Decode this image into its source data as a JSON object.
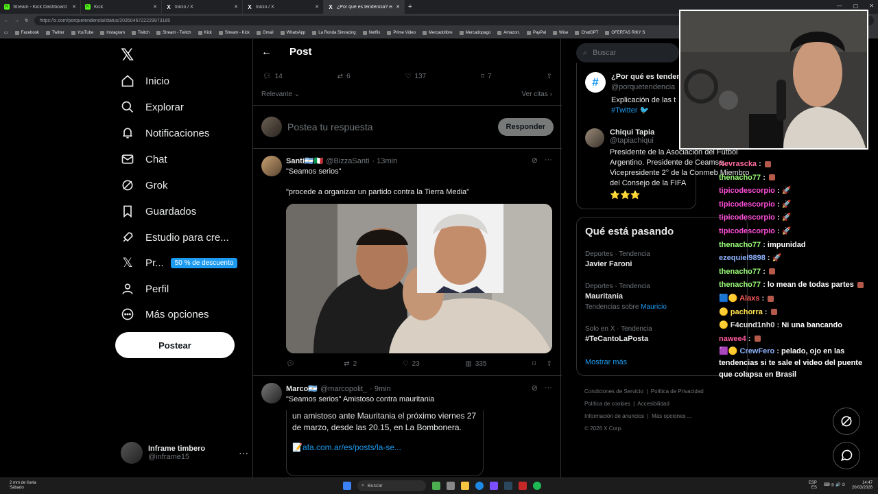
{
  "browser": {
    "tabs": [
      {
        "title": "Stream - Kick Dashboard",
        "icon": "kick-icon",
        "active": false
      },
      {
        "title": "Kick",
        "icon": "kick-icon",
        "active": false
      },
      {
        "title": "Inicio / X",
        "icon": "x-icon",
        "active": false
      },
      {
        "title": "Inicio / X",
        "icon": "x-icon",
        "active": false
      },
      {
        "title": "¿Por qué es tendencia? en X",
        "icon": "x-icon",
        "active": true
      }
    ],
    "url": "https://x.com/porquetendencia/status/2035046722229973185",
    "bookmarks": [
      "Facebook",
      "Twitter",
      "YouTube",
      "Instagram",
      "Twitch",
      "Stream - Twitch",
      "Kick",
      "Stream - Kick",
      "Gmail",
      "WhatsApp",
      "La Ronda Simracing",
      "Netflix",
      "Prime Video",
      "Mercadolibre",
      "Mercadopago",
      "Amazon.",
      "PayPal",
      "Wise",
      "ChatGPT",
      "OFERTAS RIKY S"
    ]
  },
  "nav": {
    "items": [
      {
        "label": "Inicio",
        "icon": "home-icon"
      },
      {
        "label": "Explorar",
        "icon": "search-icon"
      },
      {
        "label": "Notificaciones",
        "icon": "bell-icon"
      },
      {
        "label": "Chat",
        "icon": "mail-icon"
      },
      {
        "label": "Grok",
        "icon": "grok-icon"
      },
      {
        "label": "Guardados",
        "icon": "bookmark-icon"
      },
      {
        "label": "Estudio para cre...",
        "icon": "rocket-icon"
      },
      {
        "label": "Pr...",
        "icon": "x-premium-icon"
      },
      {
        "label": "Perfil",
        "icon": "person-icon"
      },
      {
        "label": "Más opciones",
        "icon": "more-circle-icon"
      }
    ],
    "premium_badge": "50 % de descuento",
    "post_button": "Postear",
    "account": {
      "name": "Inframe timbero",
      "handle": "@inframe15"
    }
  },
  "main": {
    "header": "Post",
    "stats": {
      "replies": "14",
      "reposts": "6",
      "likes": "137",
      "bookmarks": "7"
    },
    "sort_label": "Relevante",
    "quotes_link": "Ver citas",
    "reply_placeholder": "Postea tu respuesta",
    "reply_button": "Responder",
    "tweets": [
      {
        "name": "Santi🇦🇷🇮🇹",
        "handle": "@BizzaSanti",
        "time": "· 13min",
        "text1": "\"Seamos serios\"",
        "text2": "\"procede a organizar un partido contra la Tierra Media\"",
        "replies": "",
        "reposts": "2",
        "likes": "23",
        "views": "335"
      },
      {
        "name": "Marco🇦🇷",
        "handle": "@marcopolit_",
        "time": "· 9min",
        "text1": "\"Seamos serios\" Amistoso contra mauritania",
        "quote": "un amistoso ante Mauritania el próximo viernes 27 de marzo, desde las 20.15, en La Bombonera.",
        "quote_link": "📝afa.com.ar/es/posts/la-se..."
      }
    ]
  },
  "sidebar": {
    "search_placeholder": "Buscar",
    "account1": {
      "name": "¿Por qué es tenden",
      "handle": "@porquetendencia",
      "bio": "Explicación de las t",
      "tag": "#Twitter 🐦"
    },
    "account2": {
      "name": "Chiqui Tapia",
      "handle": "@tapiachiqui",
      "bio": "Presidente de la Asociación del Fútbol Argentino. Presidente de Ceamse. Vicepresidente 2° de la Conmeb Miembro del Consejo de la FIFA",
      "stars": "⭐⭐⭐"
    },
    "trending_title": "Qué está pasando",
    "trends": [
      {
        "context": "Deportes · Tendencia",
        "name": "Javier Faroni",
        "sub_prefix": "",
        "sub_link": ""
      },
      {
        "context": "Deportes · Tendencia",
        "name": "Mauritania",
        "sub_prefix": "Tendencias sobre ",
        "sub_link": "Mauricio"
      },
      {
        "context": "Solo en X · Tendencia",
        "name": "#TeCantoLaPosta",
        "sub_prefix": "",
        "sub_link": ""
      }
    ],
    "show_more": "Mostrar más",
    "footer": [
      "Condiciones de Servicio",
      "Política de Privacidad",
      "Política de cookies",
      "Accesibilidad",
      "Información de anuncios",
      "Más opciones ...",
      "© 2026 X Corp."
    ]
  },
  "stream_chat": [
    {
      "user": "Nevrascka",
      "color": "#ff6b9d",
      "msg": ""
    },
    {
      "user": "thenacho77",
      "color": "#9cff7a",
      "msg": ""
    },
    {
      "user": "tipicodescorpio",
      "color": "#ff4fd8",
      "msg": ""
    },
    {
      "user": "tipicodescorpio",
      "color": "#ff4fd8",
      "msg": ""
    },
    {
      "user": "tipicodescorpio",
      "color": "#ff4fd8",
      "msg": ""
    },
    {
      "user": "tipicodescorpio",
      "color": "#ff4fd8",
      "msg": ""
    },
    {
      "user": "thenacho77",
      "color": "#9cff7a",
      "msg": "impunidad"
    },
    {
      "user": "ezequiel9898",
      "color": "#8fb4ff",
      "msg": ""
    },
    {
      "user": "thenacho77",
      "color": "#9cff7a",
      "msg": ""
    },
    {
      "user": "thenacho77",
      "color": "#9cff7a",
      "msg": "lo mean de todas partes"
    },
    {
      "user": "Alaxs",
      "color": "#ff5a5a",
      "msg": ""
    },
    {
      "user": "pachorra",
      "color": "#ffe14d",
      "msg": ""
    },
    {
      "user": "F4cund1nh0",
      "color": "#e0e0e0",
      "msg": "Ni una bancando"
    },
    {
      "user": "nawee4",
      "color": "#ff5aa0",
      "msg": ""
    },
    {
      "user": "CrewFero",
      "color": "#8fb4ff",
      "msg": "pelado, ojo en las tendencias si te sale el video del puente que colapsa en Brasil"
    }
  ],
  "taskbar": {
    "weather_line1": "2 mm de lluvia",
    "weather_line2": "Sábado",
    "search": "Buscar",
    "lang1": "ESP",
    "lang2": "ES",
    "time": "14:47",
    "date": "20/03/2026"
  },
  "colors": {
    "accent": "#1d9bf0",
    "background": "#000000",
    "border": "#2f3336",
    "muted": "#71767b"
  }
}
